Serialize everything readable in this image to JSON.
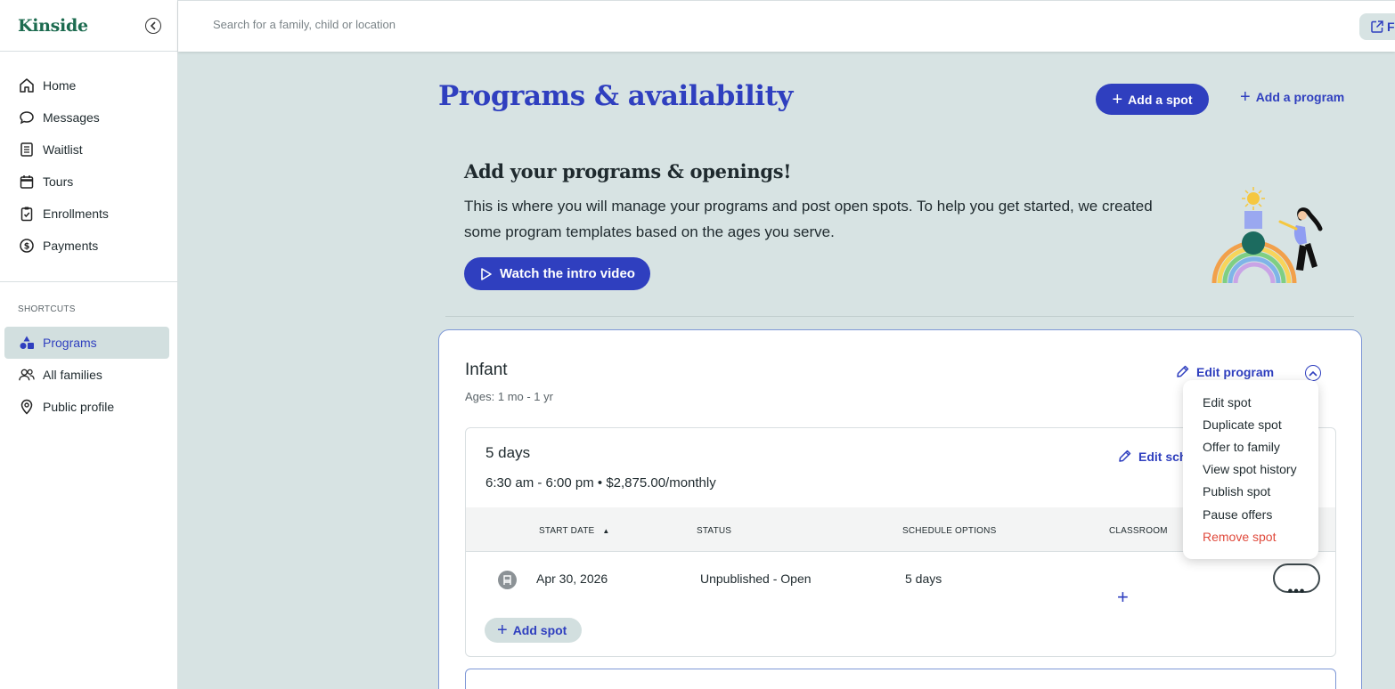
{
  "app": {
    "logo": "Kinside"
  },
  "search": {
    "placeholder": "Search for a family, child or location"
  },
  "topbar": {
    "right_button_label": "F"
  },
  "sidebar": {
    "nav": [
      {
        "label": "Home",
        "icon": "home-icon"
      },
      {
        "label": "Messages",
        "icon": "chat-bubble-icon"
      },
      {
        "label": "Waitlist",
        "icon": "list-icon"
      },
      {
        "label": "Tours",
        "icon": "calendar-icon"
      },
      {
        "label": "Enrollments",
        "icon": "clipboard-check-icon"
      },
      {
        "label": "Payments",
        "icon": "dollar-circle-icon"
      }
    ],
    "shortcuts_label": "SHORTCUTS",
    "shortcuts": [
      {
        "label": "Programs",
        "icon": "shapes-icon",
        "active": true
      },
      {
        "label": "All families",
        "icon": "people-icon"
      },
      {
        "label": "Public profile",
        "icon": "location-pin-icon"
      }
    ]
  },
  "header": {
    "title": "Programs & availability",
    "add_spot_label": "Add a spot",
    "add_program_label": "Add a program"
  },
  "intro": {
    "heading": "Add your programs & openings!",
    "body": "This is where you will manage your programs and post open spots. To help you get started, we created some program templates based on the ages you serve.",
    "video_button": "Watch the intro video"
  },
  "program": {
    "name": "Infant",
    "ages": "Ages: 1 mo - 1 yr",
    "edit_label": "Edit program",
    "schedule": {
      "title": "5 days",
      "subtitle": "6:30 am - 6:00 pm • $2,875.00/monthly",
      "edit_label": "Edit sch",
      "columns": [
        "START DATE",
        "STATUS",
        "SCHEDULE OPTIONS",
        "CLASSROOM"
      ],
      "rows": [
        {
          "start_date": "Apr 30, 2026",
          "status": "Unpublished - Open",
          "schedule_options": "5 days"
        }
      ],
      "add_spot_label": "Add spot"
    }
  },
  "menu": {
    "items": [
      "Edit spot",
      "Duplicate spot",
      "Offer to family",
      "View spot history",
      "Publish spot",
      "Pause offers",
      "Remove spot"
    ]
  },
  "colors": {
    "accent": "#2f3fbf",
    "brand": "#1c6b4f",
    "background": "#d7e3e3",
    "danger": "#e04a3c"
  }
}
